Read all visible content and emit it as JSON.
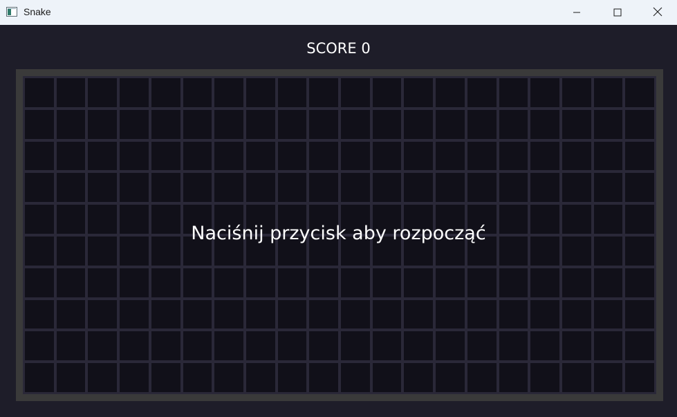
{
  "window": {
    "title": "Snake",
    "icon": "app-window-icon",
    "controls": {
      "minimize_icon": "minimize-icon",
      "maximize_icon": "maximize-icon",
      "close_icon": "close-icon"
    }
  },
  "game": {
    "score_text": "SCORE 0",
    "start_message": "Naciśnij przycisk aby rozpocząć",
    "grid": {
      "columns": 20,
      "rows": 10
    }
  },
  "colors": {
    "background": "#1e1d29",
    "board_frame": "#3a3a3a",
    "grid_lines": "#2a2838",
    "cell": "#111019",
    "text": "#ffffff"
  }
}
